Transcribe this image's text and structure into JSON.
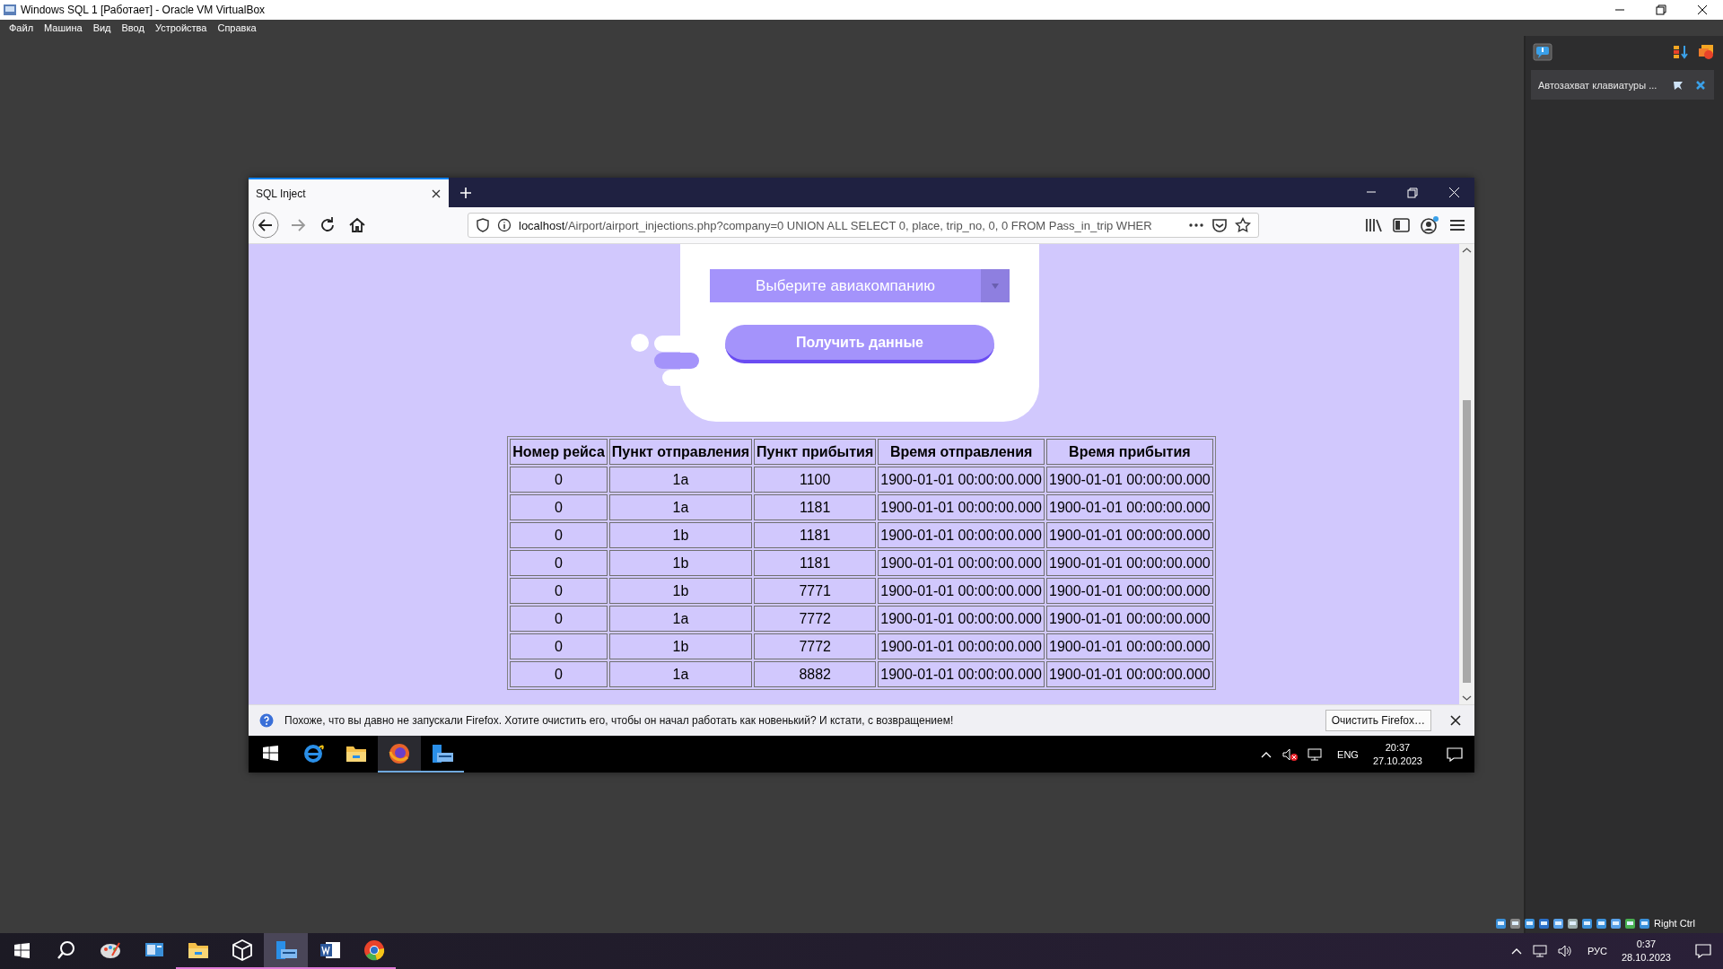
{
  "window": {
    "title": "Windows SQL 1 [Работает] - Oracle VM VirtualBox"
  },
  "menu": [
    "Файл",
    "Машина",
    "Вид",
    "Ввод",
    "Устройства",
    "Справка"
  ],
  "side_panel": {
    "notification": "Автозахват клавиатуры ..."
  },
  "browser": {
    "tabs": [
      {
        "title": "SQL Inject",
        "selected": true
      }
    ],
    "url": {
      "host": "localhost",
      "rest": "/Airport/airport_injections.php?company=0 UNION ALL SELECT 0, place, trip_no, 0, 0 FROM Pass_in_trip WHER"
    },
    "page": {
      "select_placeholder": "Выберите авиакомпанию",
      "submit": "Получить данные",
      "table": {
        "columns": [
          "Номер рейса",
          "Пункт отправления",
          "Пункт прибытия",
          "Время отправления",
          "Время прибытия"
        ],
        "rows": [
          [
            "0",
            "1a",
            "1100",
            "1900-01-01 00:00:00.000",
            "1900-01-01 00:00:00.000"
          ],
          [
            "0",
            "1a",
            "1181",
            "1900-01-01 00:00:00.000",
            "1900-01-01 00:00:00.000"
          ],
          [
            "0",
            "1b",
            "1181",
            "1900-01-01 00:00:00.000",
            "1900-01-01 00:00:00.000"
          ],
          [
            "0",
            "1b",
            "1181",
            "1900-01-01 00:00:00.000",
            "1900-01-01 00:00:00.000"
          ],
          [
            "0",
            "1b",
            "7771",
            "1900-01-01 00:00:00.000",
            "1900-01-01 00:00:00.000"
          ],
          [
            "0",
            "1a",
            "7772",
            "1900-01-01 00:00:00.000",
            "1900-01-01 00:00:00.000"
          ],
          [
            "0",
            "1b",
            "7772",
            "1900-01-01 00:00:00.000",
            "1900-01-01 00:00:00.000"
          ],
          [
            "0",
            "1a",
            "8882",
            "1900-01-01 00:00:00.000",
            "1900-01-01 00:00:00.000"
          ]
        ]
      }
    },
    "notification": {
      "message": "Похоже, что вы давно не запускали Firefox. Хотите очистить его, чтобы он начал работать как новенький? И кстати, с возвращением!",
      "button": "Очистить Firefox…"
    }
  },
  "guest_taskbar": {
    "apps": [
      {
        "kind": "ie",
        "open": false,
        "selected": false
      },
      {
        "kind": "folder",
        "open": false,
        "selected": false
      },
      {
        "kind": "firefox",
        "open": true,
        "selected": true
      },
      {
        "kind": "server",
        "open": true,
        "selected": false
      }
    ],
    "lang": "ENG",
    "time": "20:37",
    "date": "27.10.2023"
  },
  "status_bar": {
    "host_key": "Right Ctrl"
  },
  "host_taskbar": {
    "apps": [
      {
        "kind": "paint",
        "open": false,
        "selected": false
      },
      {
        "kind": "screen",
        "open": false,
        "selected": false
      },
      {
        "kind": "folder",
        "open": true,
        "selected": false
      },
      {
        "kind": "cube",
        "open": true,
        "selected": false
      },
      {
        "kind": "server",
        "open": true,
        "selected": true
      },
      {
        "kind": "word",
        "open": true,
        "selected": false
      },
      {
        "kind": "chrome",
        "open": true,
        "selected": false
      }
    ],
    "lang": "РУС",
    "time": "0:37",
    "date": "28.10.2023"
  }
}
